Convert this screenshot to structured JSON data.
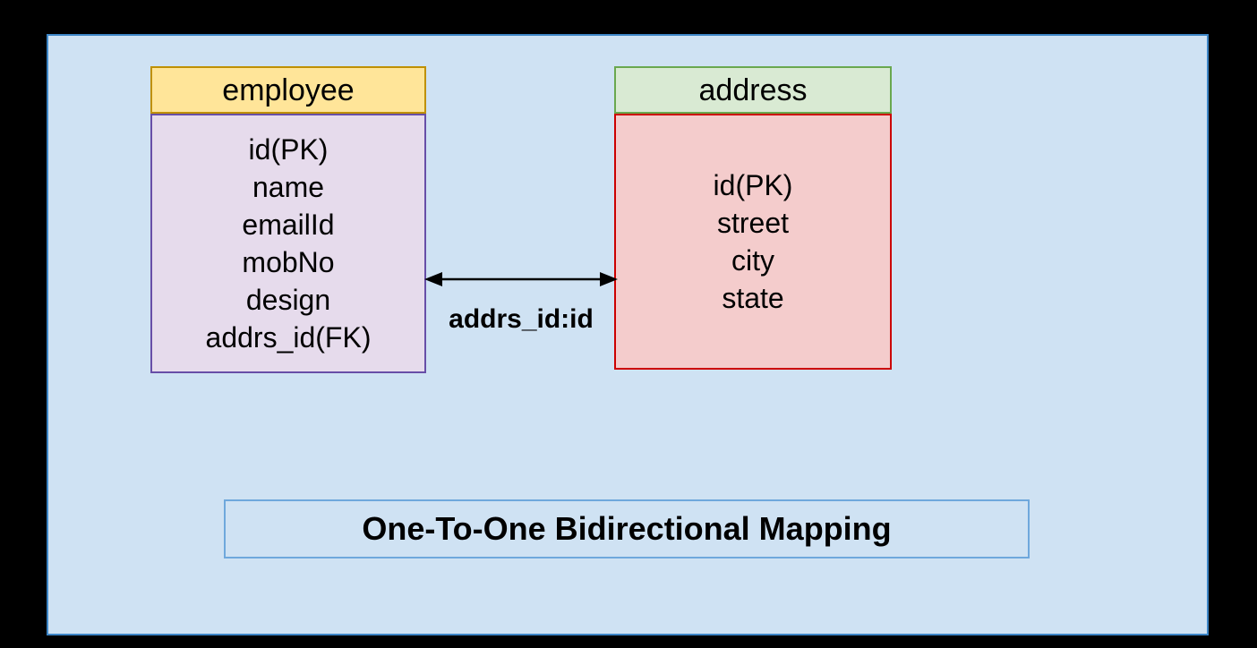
{
  "entities": {
    "employee": {
      "title": "employee",
      "fields": [
        "id(PK)",
        "name",
        "emailId",
        "mobNo",
        "design",
        "addrs_id(FK)"
      ]
    },
    "address": {
      "title": "address",
      "fields": [
        "id(PK)",
        "street",
        "city",
        "state"
      ]
    }
  },
  "relationship": {
    "label": "addrs_id:id"
  },
  "caption": "One-To-One Bidirectional Mapping"
}
